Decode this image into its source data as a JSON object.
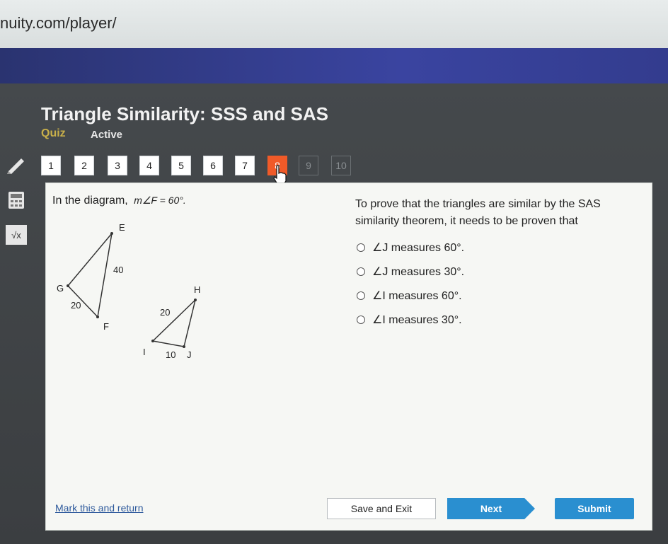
{
  "browser": {
    "url": "nuity.com/player/"
  },
  "header": {
    "title": "Triangle Similarity: SSS and SAS",
    "type_label": "Quiz",
    "status_label": "Active"
  },
  "tools": [
    {
      "icon": "pencil-icon"
    },
    {
      "icon": "calculator-icon"
    },
    {
      "icon": "sqrt-formula-icon",
      "glyph": "√x"
    }
  ],
  "question_nav": {
    "items": [
      "1",
      "2",
      "3",
      "4",
      "5",
      "6",
      "7",
      "8",
      "9",
      "10"
    ],
    "current": "8"
  },
  "question": {
    "stem_prefix": "In the diagram,",
    "stem_math": "m∠F = 60°.",
    "prompt": "To prove that the triangles are similar by the SAS similarity theorem, it needs to be proven that",
    "options": [
      {
        "label": "∠J measures 60°."
      },
      {
        "label": "∠J measures 30°."
      },
      {
        "label": "∠I measures 60°."
      },
      {
        "label": "∠I measures 30°."
      }
    ]
  },
  "diagram": {
    "triangle1": {
      "vertices": [
        "E",
        "G",
        "F"
      ],
      "side_EF": "40",
      "side_GF": "20"
    },
    "triangle2": {
      "vertices": [
        "H",
        "I",
        "J"
      ],
      "side_HI": "20",
      "side_IJ": "10"
    }
  },
  "footer": {
    "mark_link": "Mark this and return",
    "save_label": "Save and Exit",
    "next_label": "Next",
    "submit_label": "Submit"
  }
}
